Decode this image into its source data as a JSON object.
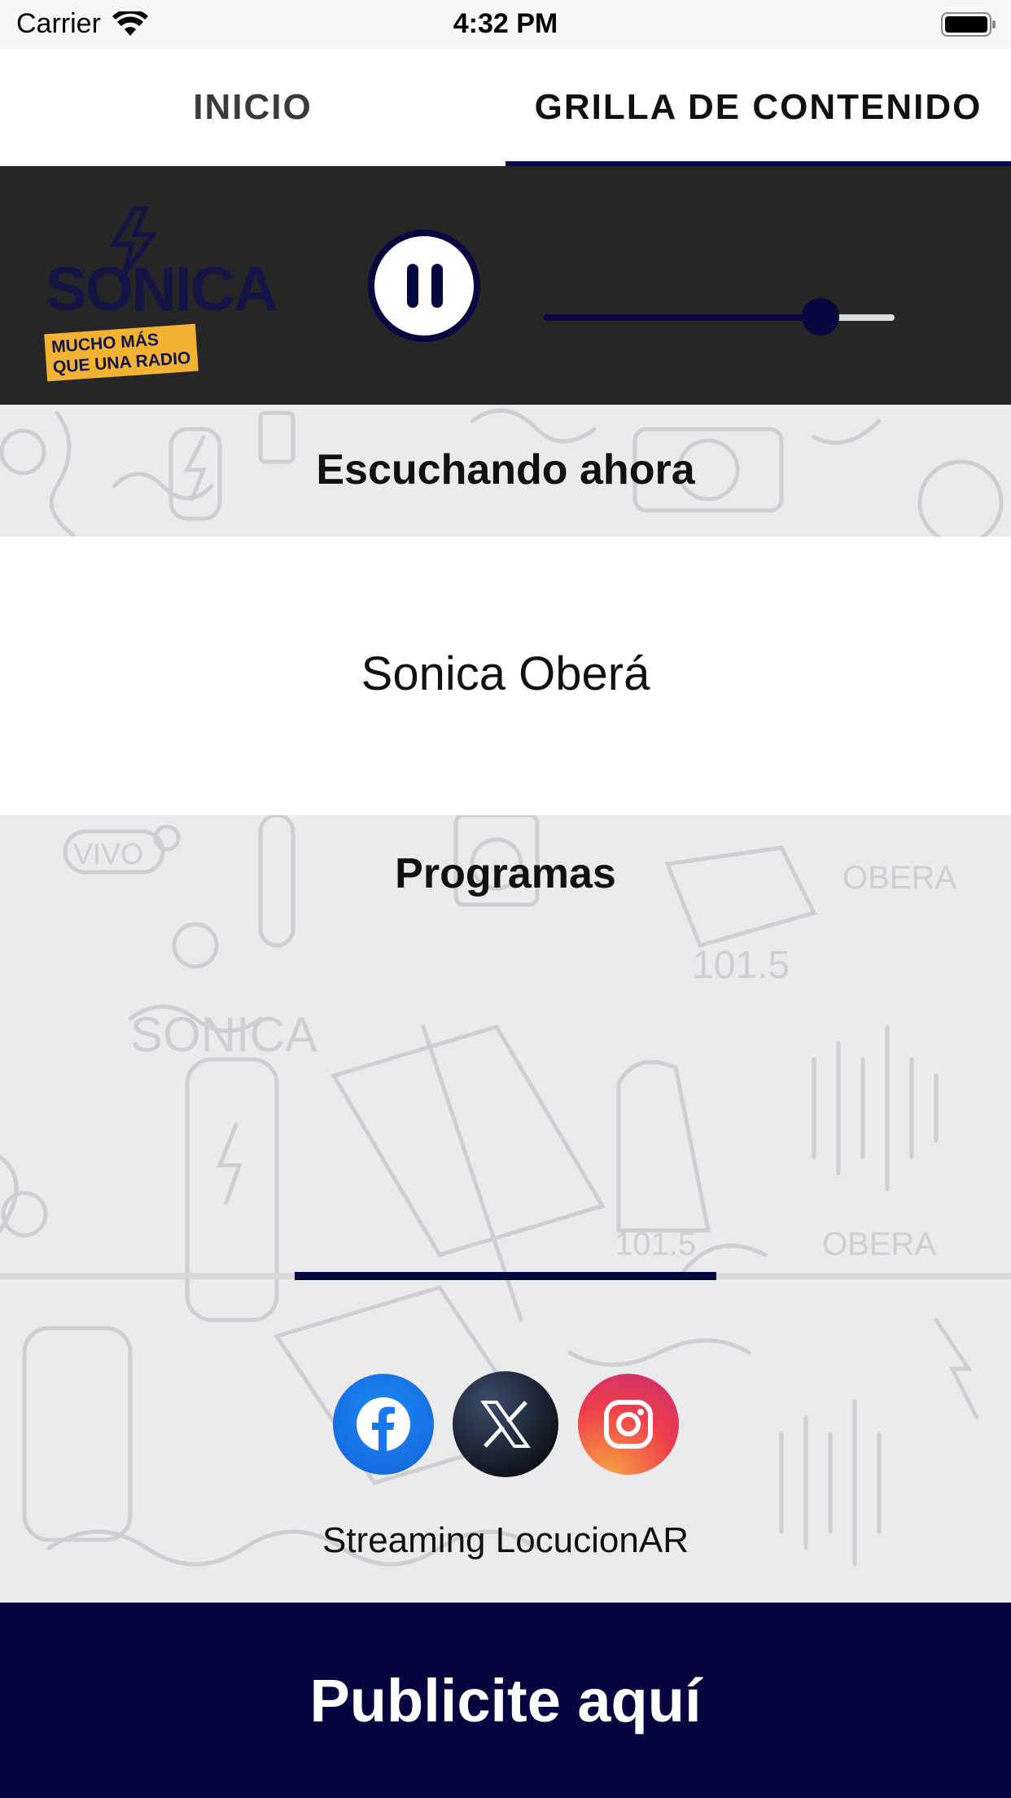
{
  "status_bar": {
    "carrier": "Carrier",
    "time": "4:32 PM"
  },
  "tabs": [
    {
      "label": "INICIO",
      "active": false
    },
    {
      "label": "GRILLA DE CONTENIDO",
      "active": true
    }
  ],
  "player": {
    "logo_text": "SONICA",
    "logo_tagline": "MUCHO MÁS QUE UNA RADIO",
    "volume_fraction": 0.79,
    "state": "playing"
  },
  "now_playing": {
    "title": "Escuchando ahora",
    "station": "Sonica Oberá"
  },
  "programs": {
    "title": "Programas"
  },
  "social": [
    {
      "icon": "facebook-icon",
      "color": "#1877f2"
    },
    {
      "icon": "x-icon",
      "color": "#000000"
    },
    {
      "icon": "instagram-icon",
      "color": "#e1306c"
    }
  ],
  "footer": {
    "credit": "Streaming LocucionAR"
  },
  "banner": {
    "label": "Publicite aquí",
    "color": "#07053f"
  }
}
